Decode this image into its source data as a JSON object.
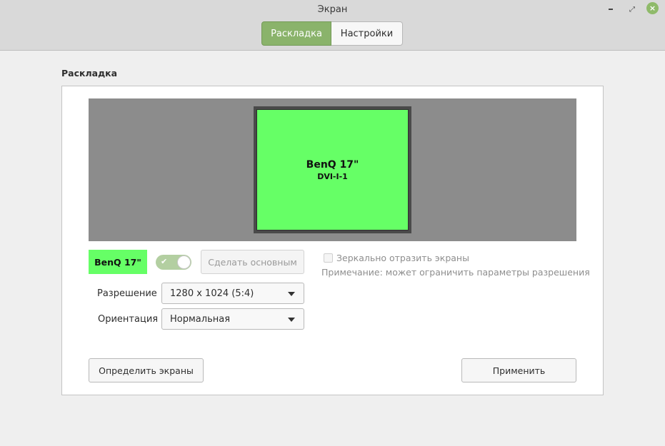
{
  "window": {
    "title": "Экран",
    "controls": {
      "minimize": "minimize-icon",
      "maximize": "maximize-icon",
      "close": "close-icon",
      "close_glyph": "×",
      "maximize_glyph": "⤢"
    },
    "accent_color": "#8ab36b"
  },
  "tabs": [
    {
      "label": "Раскладка",
      "active": true
    },
    {
      "label": "Настройки",
      "active": false
    }
  ],
  "layout": {
    "section_title": "Раскладка",
    "monitor": {
      "name": "BenQ 17\"",
      "port": "DVI-I-1",
      "color": "#66ff66"
    }
  },
  "display": {
    "label": "BenQ 17\"",
    "enabled": true,
    "check_glyph": "✔",
    "set_primary_label": "Сделать основным",
    "mirror_label": "Зеркально отразить экраны",
    "mirror_checked": false,
    "note": "Примечание: может ограничить параметры разрешения"
  },
  "fields": {
    "resolution": {
      "label": "Разрешение",
      "value": "1280 x 1024 (5:4)"
    },
    "orientation": {
      "label": "Ориентация",
      "value": "Нормальная"
    }
  },
  "buttons": {
    "detect": "Определить экраны",
    "apply": "Применить"
  }
}
